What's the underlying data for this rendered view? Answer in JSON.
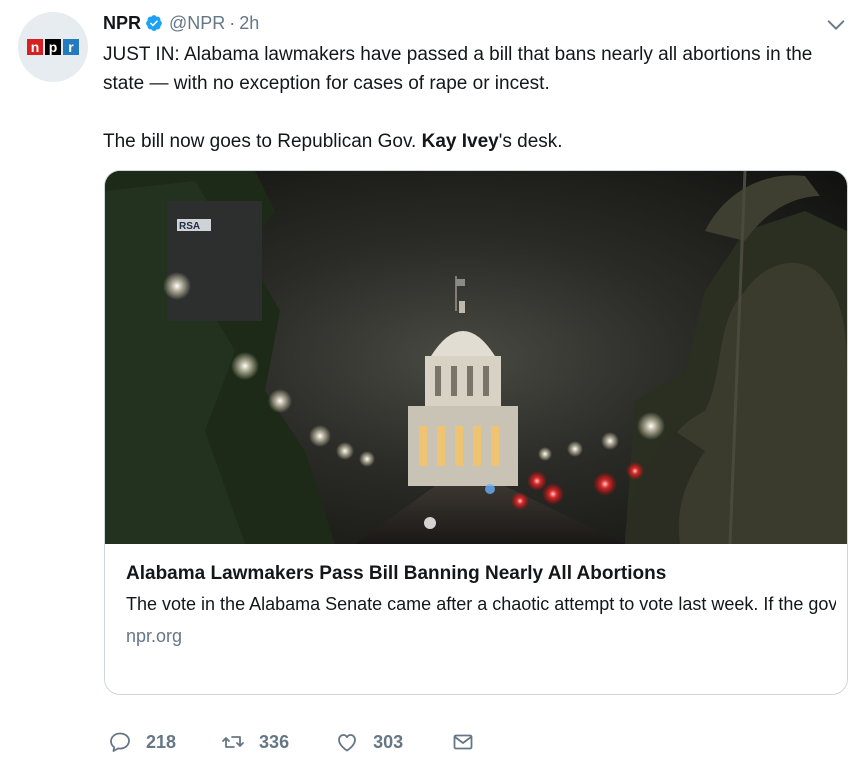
{
  "tweet": {
    "author_name": "NPR",
    "handle": "@NPR",
    "separator": "·",
    "time": "2h",
    "avatar_letters": [
      "n",
      "p",
      "r"
    ],
    "avatar_colors": [
      "#d62021",
      "#000000",
      "#237bbd"
    ],
    "text_line1": "JUST IN: Alabama lawmakers have passed a bill that bans nearly all abortions in the state — with no exception for cases of rape or incest.",
    "text_line2_before": "The bill now goes to Republican Gov. ",
    "text_line2_mention": "Kay Ivey",
    "text_line2_after": "'s desk."
  },
  "card": {
    "image_sign_text": "RSA",
    "title": "Alabama Lawmakers Pass Bill Banning Nearly All Abortions",
    "description": "The vote in the Alabama Senate came after a chaotic attempt to vote last week. If the governor signs the bill into law, it will become among the most ...",
    "domain": "npr.org"
  },
  "actions": {
    "reply_count": "218",
    "retweet_count": "336",
    "like_count": "303"
  },
  "colors": {
    "verified": "#1da1f2",
    "secondary_text": "#657786",
    "border": "#ccd6dd"
  }
}
